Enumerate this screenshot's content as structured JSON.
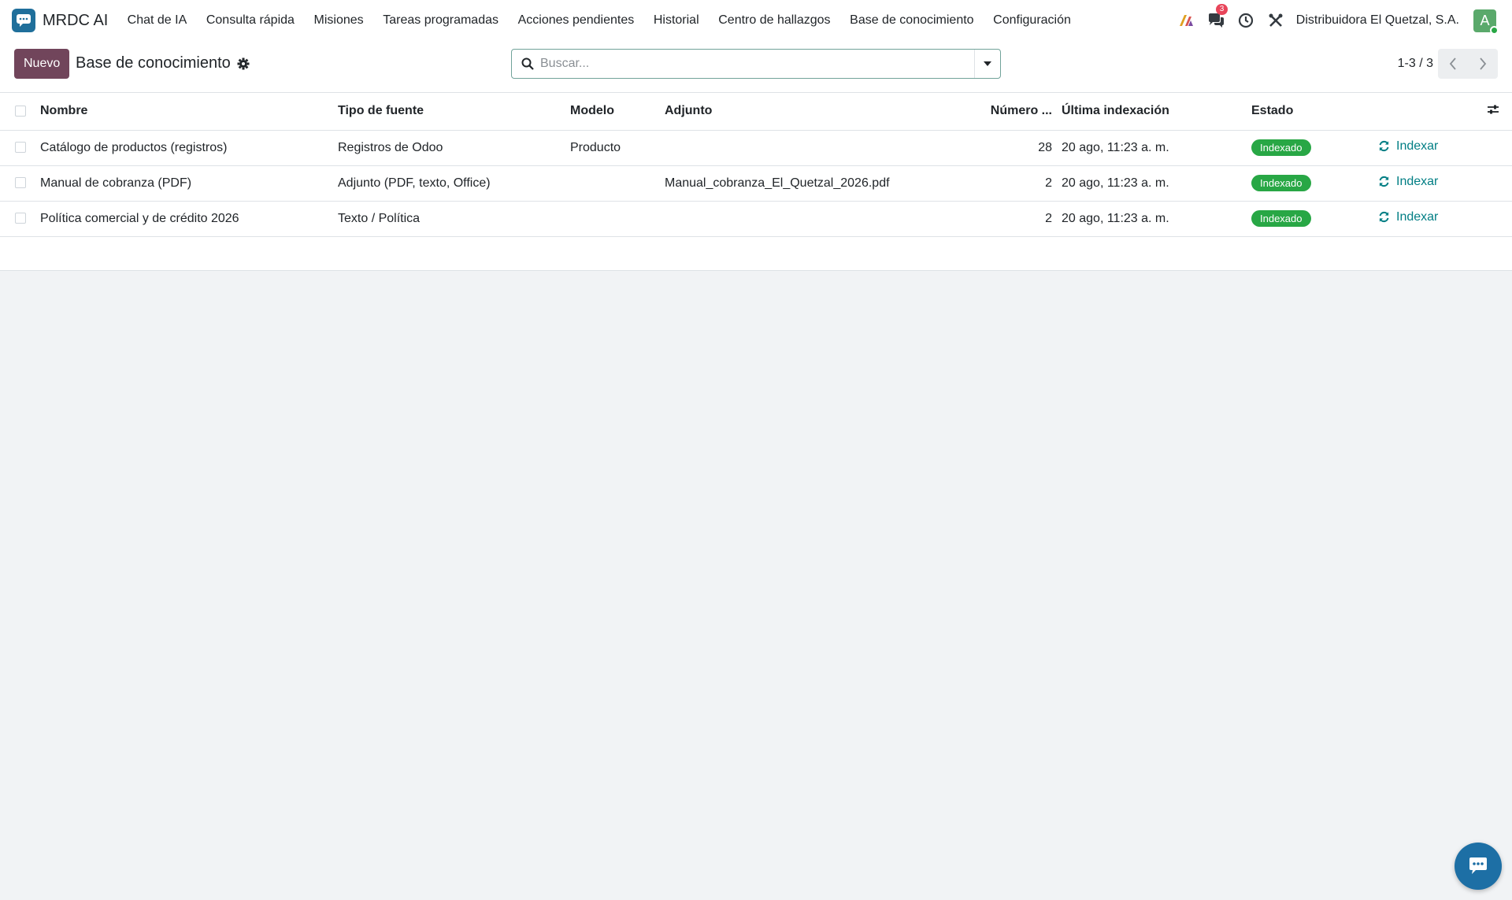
{
  "navbar": {
    "app_name": "MRDC AI",
    "menu": [
      {
        "label": "Chat de IA"
      },
      {
        "label": "Consulta rápida"
      },
      {
        "label": "Misiones"
      },
      {
        "label": "Tareas programadas"
      },
      {
        "label": "Acciones pendientes"
      },
      {
        "label": "Historial"
      },
      {
        "label": "Centro de hallazgos"
      },
      {
        "label": "Base de conocimiento"
      },
      {
        "label": "Configuración"
      }
    ],
    "messages_badge": "3",
    "company": "Distribuidora El Quetzal, S.A.",
    "avatar_initial": "A"
  },
  "control_panel": {
    "new_button": "Nuevo",
    "breadcrumb": "Base de conocimiento",
    "search_placeholder": "Buscar...",
    "pager": "1-3 / 3"
  },
  "table": {
    "columns": {
      "name": "Nombre",
      "source_type": "Tipo de fuente",
      "model": "Modelo",
      "attachment": "Adjunto",
      "number": "Número ...",
      "last_indexed": "Última indexación",
      "status": "Estado"
    },
    "rows": [
      {
        "name": "Catálogo de productos (registros)",
        "source_type": "Registros de Odoo",
        "model": "Producto",
        "attachment": "",
        "number": "28",
        "last_indexed": "20 ago, 11:23 a. m.",
        "status": "Indexado",
        "action": "Indexar"
      },
      {
        "name": "Manual de cobranza (PDF)",
        "source_type": "Adjunto (PDF, texto, Office)",
        "model": "",
        "attachment": "Manual_cobranza_El_Quetzal_2026.pdf",
        "number": "2",
        "last_indexed": "20 ago, 11:23 a. m.",
        "status": "Indexado",
        "action": "Indexar"
      },
      {
        "name": "Política comercial y de crédito 2026",
        "source_type": "Texto / Política",
        "model": "",
        "attachment": "",
        "number": "2",
        "last_indexed": "20 ago, 11:23 a. m.",
        "status": "Indexado",
        "action": "Indexar"
      }
    ]
  },
  "colors": {
    "brand": "#71455b",
    "status_indexed": "#28a745",
    "action_link": "#017e84",
    "badge": "#e8455a"
  },
  "icons": [
    "app-logo-icon",
    "ai-icon",
    "chat-icon",
    "clock-icon",
    "tools-icon",
    "gear-icon",
    "search-icon",
    "caret-down-icon",
    "chevron-left-icon",
    "chevron-right-icon",
    "column-settings-icon",
    "refresh-icon",
    "chat-fab-icon"
  ]
}
